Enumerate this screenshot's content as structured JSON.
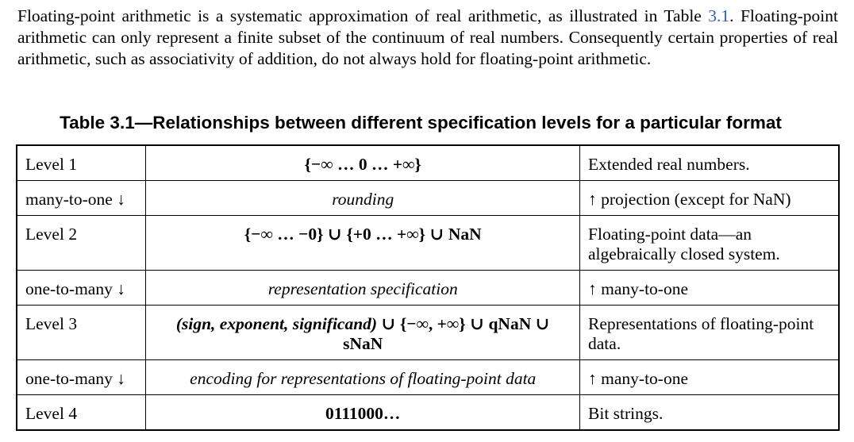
{
  "paragraph": {
    "before_ref": "Floating-point arithmetic is a systematic approximation of real arithmetic, as illustrated in Table ",
    "ref": "3.1",
    "after_ref": ". Floating-point arithmetic can only represent a finite subset of the continuum of real numbers. Consequently certain properties of real arithmetic, such as associativity of addition, do not always hold for floating-point arithmetic."
  },
  "caption": "Table 3.1—Relationships between different specification levels for a particular format",
  "table": {
    "rows": [
      {
        "c1": "Level 1",
        "c2": "{−∞ … 0 … +∞}",
        "c3": "Extended real numbers."
      },
      {
        "c1": "many-to-one ↓",
        "c2": "rounding",
        "c3": "↑ projection (except for NaN)"
      },
      {
        "c1": "Level 2",
        "c2": "{−∞ … −0} ∪ {+0 … +∞} ∪ NaN",
        "c3": "Floating-point data—an algebraically closed system."
      },
      {
        "c1": "one-to-many ↓",
        "c2": "representation specification",
        "c3": "↑ many-to-one"
      },
      {
        "c1": "Level 3",
        "c2_italic": "(sign, exponent, significand)",
        "c2_rest": " ∪ {−∞, +∞} ∪ qNaN ∪ sNaN",
        "c3": "Representations of floating-point data."
      },
      {
        "c1": "one-to-many ↓",
        "c2": "encoding for representations of floating-point data",
        "c3": "↑ many-to-one"
      },
      {
        "c1": "Level 4",
        "c2": "0111000…",
        "c3": "Bit strings."
      }
    ]
  }
}
